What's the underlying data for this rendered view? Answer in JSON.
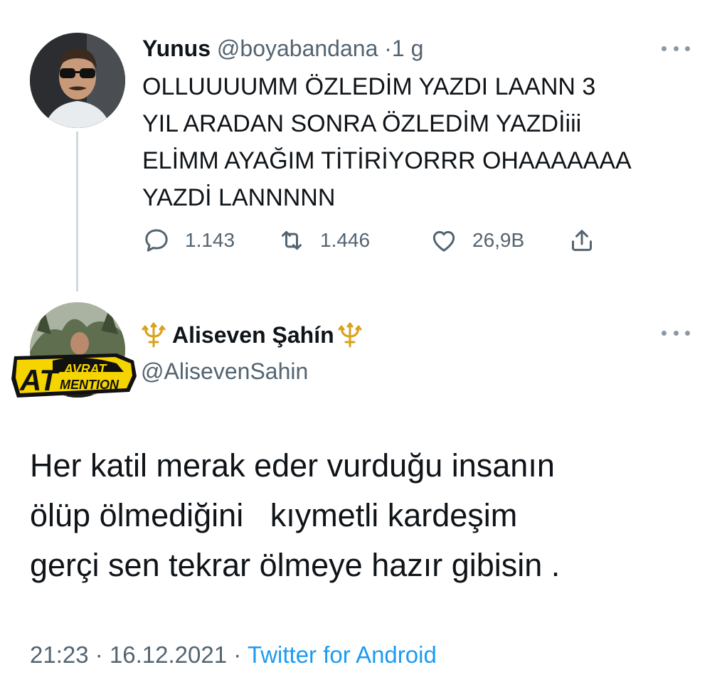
{
  "parent_tweet": {
    "display_name": "Yunus",
    "handle": "@boyabandana",
    "separator": "·",
    "time": "1 g",
    "lines": [
      "OLLUUUUMM ÖZLEDİM YAZDI LAANN 3",
      "YIL ARADAN SONRA ÖZLEDİM YAZDİiii",
      "ELİMM AYAĞIM TİTİRİYORRR OHAAAAAAA",
      "YAZDİ LANNNNN"
    ],
    "reply_count": "1.143",
    "retweet_count": "1.446",
    "like_count": "26,9B"
  },
  "reply_tweet": {
    "display_name": "Aliseven Şahín",
    "handle": "@AlisevenSahin",
    "lines": [
      "Her katil merak eder vurduğu insanın",
      "ölüp ölmediğini   kıymetli kardeşim",
      "gerçi sen tekrar ölmeye hazır gibisin ."
    ],
    "time": "21:23",
    "date": "16.12.2021",
    "separator": "·",
    "source": "Twitter for Android",
    "badge": {
      "letters": "AT",
      "word_top": "AVRAT",
      "word_bottom": "MENTION"
    }
  },
  "colors": {
    "text": "#0f1419",
    "secondary": "#536471",
    "link": "#1d9bf0",
    "thread_line": "#cfd9de",
    "badge_yellow": "#f5d400"
  },
  "icons": {
    "reply": "speech-bubble-icon",
    "retweet": "retweet-icon",
    "like": "heart-icon",
    "share": "share-icon",
    "more": "more-dots-icon",
    "emoji": "trident-emoji"
  }
}
